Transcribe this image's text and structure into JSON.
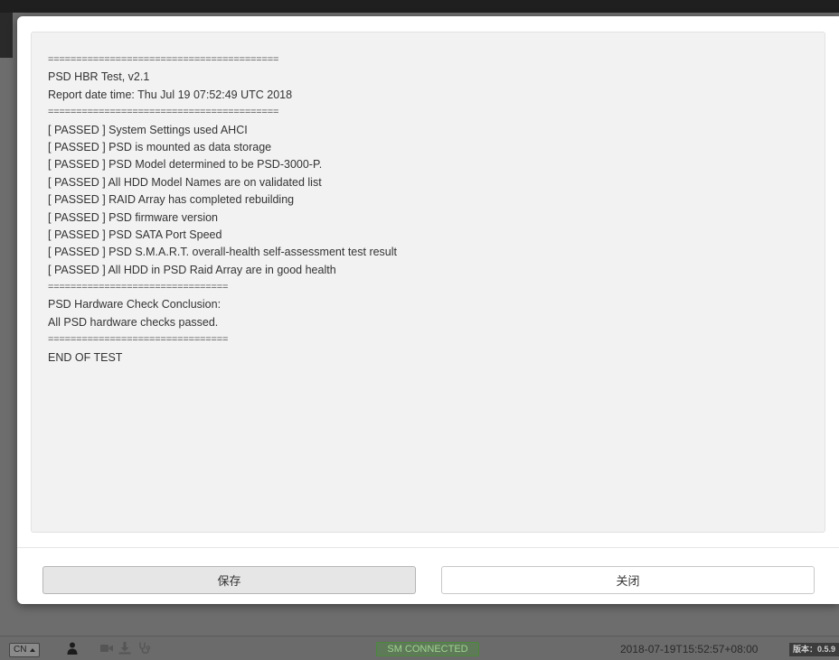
{
  "report": {
    "lines": [
      "=========================================",
      "PSD HBR Test, v2.1",
      "Report date time: Thu Jul 19 07:52:49 UTC 2018",
      "=========================================",
      "[ PASSED ] System Settings used AHCI",
      "[ PASSED ] PSD is mounted as data storage",
      "[ PASSED ] PSD Model determined to be PSD-3000-P.",
      "[ PASSED ] All HDD Model Names are on validated list",
      "[ PASSED ] RAID Array has completed rebuilding",
      "[ PASSED ] PSD firmware version",
      "[ PASSED ] PSD SATA Port Speed",
      "[ PASSED ] PSD S.M.A.R.T. overall-health self-assessment test result",
      "[ PASSED ] All HDD in PSD Raid Array are in good health",
      "================================",
      "PSD Hardware Check Conclusion:",
      "All PSD hardware checks passed.",
      "================================",
      "END OF TEST"
    ]
  },
  "buttons": {
    "save_label": "保存",
    "close_label": "关闭"
  },
  "statusbar": {
    "language": "CN",
    "sm_status": "SM CONNECTED",
    "timestamp": "2018-07-19T15:52:57+08:00",
    "version": "版本：0.5.9"
  },
  "icons": {
    "user": "user-icon",
    "camera": "video-camera-icon",
    "download": "download-icon",
    "stethoscope": "stethoscope-icon"
  },
  "colors": {
    "sm_connected_text": "#9fd490",
    "sm_connected_border": "#4a8a3a",
    "report_background": "#f2f2f2"
  }
}
